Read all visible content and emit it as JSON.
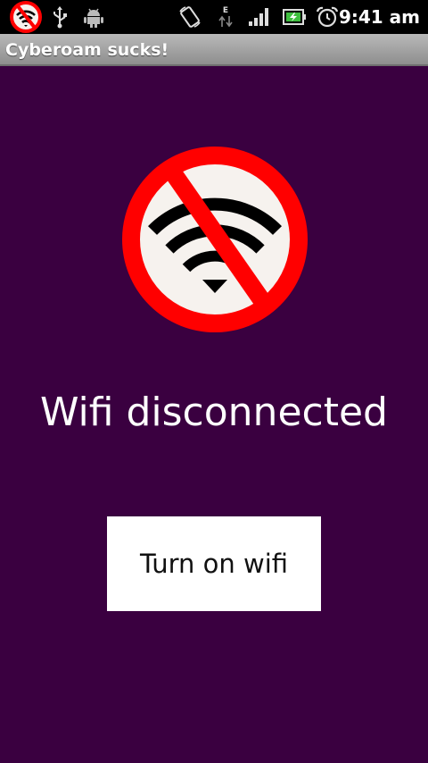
{
  "status_bar": {
    "time": "9:41 am",
    "data_indicator": "E",
    "icons": [
      "nowifi-app-icon",
      "usb-icon",
      "android-debug-icon",
      "rotate-icon",
      "data-transfer-icon",
      "signal-icon",
      "battery-charging-icon",
      "alarm-clock-icon"
    ]
  },
  "app": {
    "title": "Cyberoam sucks!"
  },
  "main": {
    "logo_icon": "no-wifi-icon",
    "message": "Wifi disconnected",
    "button_label": "Turn on wifi"
  },
  "colors": {
    "background": "#3a0040",
    "prohibition_red": "#ff0000",
    "button_bg": "#ffffff"
  }
}
